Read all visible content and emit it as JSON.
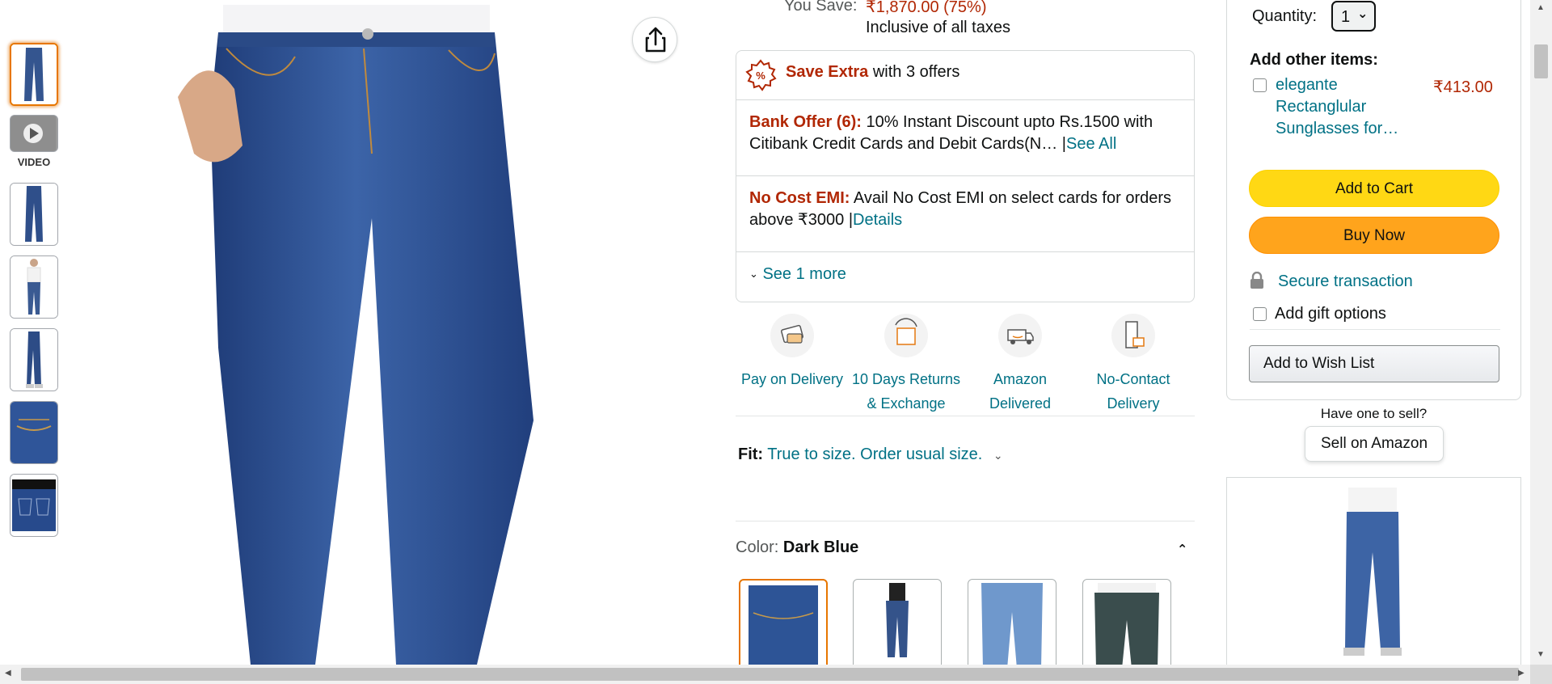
{
  "thumbnails": {
    "video_label": "VIDEO"
  },
  "share": {
    "icon": "share-icon"
  },
  "price": {
    "you_save_label": "You Save:",
    "you_save_value": "₹1,870.00 (75%)",
    "taxes_note": "Inclusive of all taxes"
  },
  "offers": {
    "header_bold": "Save Extra",
    "header_rest": " with 3 offers",
    "bank_title": "Bank Offer (6):",
    "bank_text": " 10% Instant Discount upto Rs.1500 with Citibank Credit Cards and Debit Cards(N…",
    "bank_link": "See All",
    "emi_title": "No Cost EMI:",
    "emi_text": " Avail No Cost EMI on select cards for orders above ₹3000 ",
    "emi_link": "Details",
    "see_more": "See 1 more"
  },
  "features": [
    {
      "line1": "Pay on Delivery",
      "line2": ""
    },
    {
      "line1": "10 Days Returns",
      "line2": "& Exchange"
    },
    {
      "line1": "Amazon",
      "line2": "Delivered"
    },
    {
      "line1": "No-Contact",
      "line2": "Delivery"
    }
  ],
  "fit": {
    "label": "Fit:",
    "value": "True to size. Order usual size."
  },
  "color": {
    "label": "Color:",
    "value": "Dark Blue"
  },
  "buybox": {
    "quantity_label": "Quantity:",
    "quantity_value": "1",
    "add_other_label": "Add other items:",
    "addon_line1": "elegante",
    "addon_line2": "Rectanglular",
    "addon_line3": "Sunglasses for…",
    "addon_price": "₹413.00",
    "add_to_cart": "Add to Cart",
    "buy_now": "Buy Now",
    "secure": "Secure transaction",
    "gift": "Add gift options",
    "wish_list": "Add to Wish List"
  },
  "sell": {
    "prompt": "Have one to sell?",
    "button": "Sell on Amazon"
  },
  "colors": {
    "accent_orange": "#e77600",
    "link_teal": "#007185",
    "price_red": "#b12704",
    "cart_yellow": "#ffd814",
    "buy_orange": "#ffa41c",
    "denim": "#2e4f8f"
  }
}
